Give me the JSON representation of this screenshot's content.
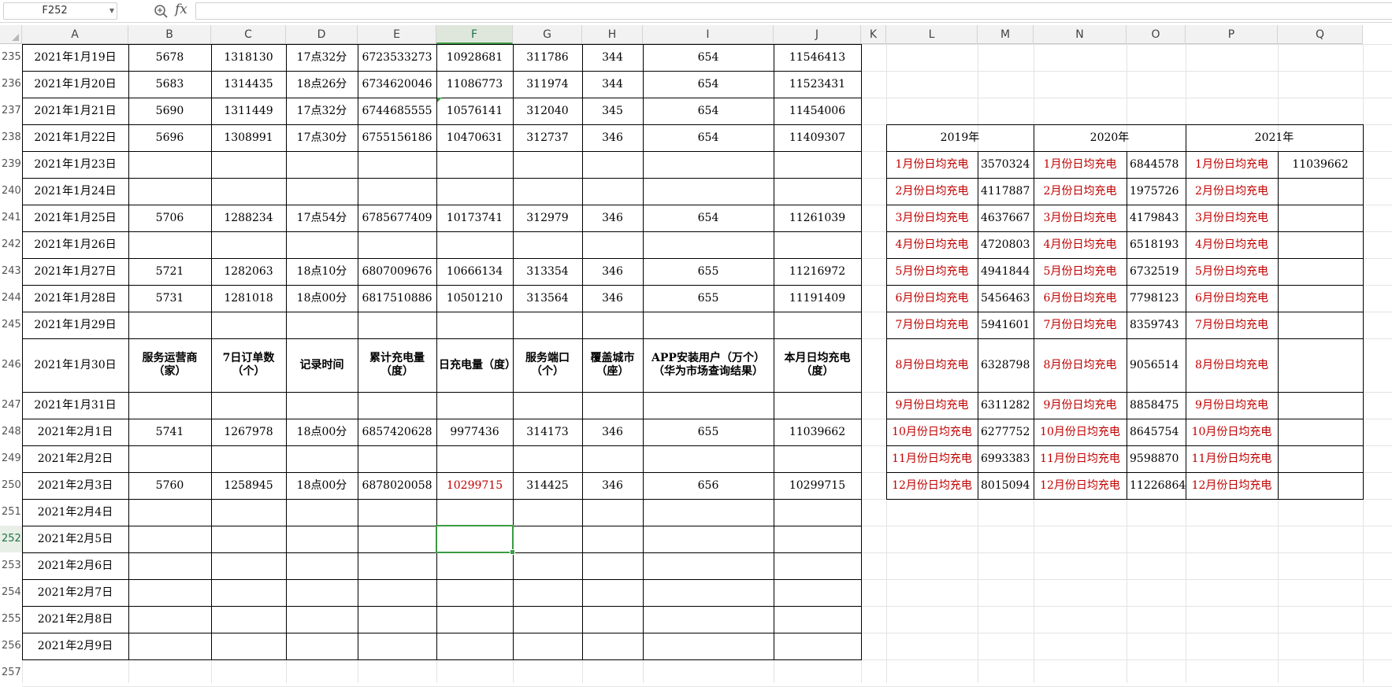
{
  "name_box": {
    "value": "F252"
  },
  "formula_bar": {
    "fx_label": "fx",
    "value": ""
  },
  "columns": [
    "A",
    "B",
    "C",
    "D",
    "E",
    "F",
    "G",
    "H",
    "I",
    "J",
    "K",
    "L",
    "M",
    "N",
    "O",
    "P",
    "Q"
  ],
  "selected_column": "F",
  "selected_row": "252",
  "selected_cell": "F252",
  "rows": [
    {
      "num": "235",
      "A": "2021年1月19日",
      "B": "5678",
      "C": "1318130",
      "D": "17点32分",
      "E": "6723533273",
      "F": "10928681",
      "G": "311786",
      "H": "344",
      "I": "654",
      "J": "11546413"
    },
    {
      "num": "236",
      "A": "2021年1月20日",
      "B": "5683",
      "C": "1314435",
      "D": "18点26分",
      "E": "6734620046",
      "F": "11086773",
      "G": "311974",
      "H": "344",
      "I": "654",
      "J": "11523431"
    },
    {
      "num": "237",
      "A": "2021年1月21日",
      "B": "5690",
      "C": "1311449",
      "D": "17点32分",
      "E": "6744685555",
      "F": "10576141",
      "G": "312040",
      "H": "345",
      "I": "654",
      "J": "11454006"
    },
    {
      "num": "238",
      "A": "2021年1月22日",
      "B": "5696",
      "C": "1308991",
      "D": "17点30分",
      "E": "6755156186",
      "F": "10470631",
      "G": "312737",
      "H": "346",
      "I": "654",
      "J": "11409307",
      "L": "2019年",
      "N": "2020年",
      "P": "2021年"
    },
    {
      "num": "239",
      "A": "2021年1月23日",
      "L": "1月份日均充电",
      "M": "3570324",
      "N": "1月份日均充电",
      "O": "6844578",
      "P": "1月份日均充电",
      "Q": "11039662"
    },
    {
      "num": "240",
      "A": "2021年1月24日",
      "L": "2月份日均充电",
      "M": "4117887",
      "N": "2月份日均充电",
      "O": "1975726",
      "P": "2月份日均充电"
    },
    {
      "num": "241",
      "A": "2021年1月25日",
      "B": "5706",
      "C": "1288234",
      "D": "17点54分",
      "E": "6785677409",
      "F": "10173741",
      "G": "312979",
      "H": "346",
      "I": "654",
      "J": "11261039",
      "L": "3月份日均充电",
      "M": "4637667",
      "N": "3月份日均充电",
      "O": "4179843",
      "P": "3月份日均充电"
    },
    {
      "num": "242",
      "A": "2021年1月26日",
      "L": "4月份日均充电",
      "M": "4720803",
      "N": "4月份日均充电",
      "O": "6518193",
      "P": "4月份日均充电"
    },
    {
      "num": "243",
      "A": "2021年1月27日",
      "B": "5721",
      "C": "1282063",
      "D": "18点10分",
      "E": "6807009676",
      "F": "10666134",
      "G": "313354",
      "H": "346",
      "I": "655",
      "J": "11216972",
      "L": "5月份日均充电",
      "M": "4941844",
      "N": "5月份日均充电",
      "O": "6732519",
      "P": "5月份日均充电"
    },
    {
      "num": "244",
      "A": "2021年1月28日",
      "B": "5731",
      "C": "1281018",
      "D": "18点00分",
      "E": "6817510886",
      "F": "10501210",
      "G": "313564",
      "H": "346",
      "I": "655",
      "J": "11191409",
      "L": "6月份日均充电",
      "M": "5456463",
      "N": "6月份日均充电",
      "O": "7798123",
      "P": "6月份日均充电"
    },
    {
      "num": "245",
      "A": "2021年1月29日",
      "L": "7月份日均充电",
      "M": "5941601",
      "N": "7月份日均充电",
      "O": "8359743",
      "P": "7月份日均充电"
    },
    {
      "num": "246",
      "A": "2021年1月30日",
      "B": "服务运营商（家）",
      "C": "7日订单数（个）",
      "D": "记录时间",
      "E": "累计充电量（度）",
      "F": "日充电量（度）",
      "G": "服务端口（个）",
      "H": "覆盖城市（座）",
      "I": "APP安装用户（万个）（华为市场查询结果）",
      "J": "本月日均充电（度）",
      "L": "8月份日均充电",
      "M": "6328798",
      "N": "8月份日均充电",
      "O": "9056514",
      "P": "8月份日均充电"
    },
    {
      "num": "247",
      "A": "2021年1月31日",
      "L": "9月份日均充电",
      "M": "6311282",
      "N": "9月份日均充电",
      "O": "8858475",
      "P": "9月份日均充电"
    },
    {
      "num": "248",
      "A": "2021年2月1日",
      "B": "5741",
      "C": "1267978",
      "D": "18点00分",
      "E": "6857420628",
      "F": "9977436",
      "G": "314173",
      "H": "346",
      "I": "655",
      "J": "11039662",
      "L": "10月份日均充电",
      "M": "6277752",
      "N": "10月份日均充电",
      "O": "8645754",
      "P": "10月份日均充电"
    },
    {
      "num": "249",
      "A": "2021年2月2日",
      "L": "11月份日均充电",
      "M": "6993383",
      "N": "11月份日均充电",
      "O": "9598870",
      "P": "11月份日均充电"
    },
    {
      "num": "250",
      "A": "2021年2月3日",
      "B": "5760",
      "C": "1258945",
      "D": "18点00分",
      "E": "6878020058",
      "F": "10299715",
      "G": "314425",
      "H": "346",
      "I": "656",
      "J": "10299715",
      "L": "12月份日均充电",
      "M": "8015094",
      "N": "12月份日均充电",
      "O": "11226864",
      "P": "12月份日均充电"
    },
    {
      "num": "251",
      "A": "2021年2月4日"
    },
    {
      "num": "252",
      "A": "2021年2月5日"
    },
    {
      "num": "253",
      "A": "2021年2月6日"
    },
    {
      "num": "254",
      "A": "2021年2月7日"
    },
    {
      "num": "255",
      "A": "2021年2月8日"
    },
    {
      "num": "256",
      "A": "2021年2月9日"
    },
    {
      "num": "257"
    }
  ],
  "colors": {
    "accent": "#3c9a44",
    "red_text": "#c00000"
  }
}
